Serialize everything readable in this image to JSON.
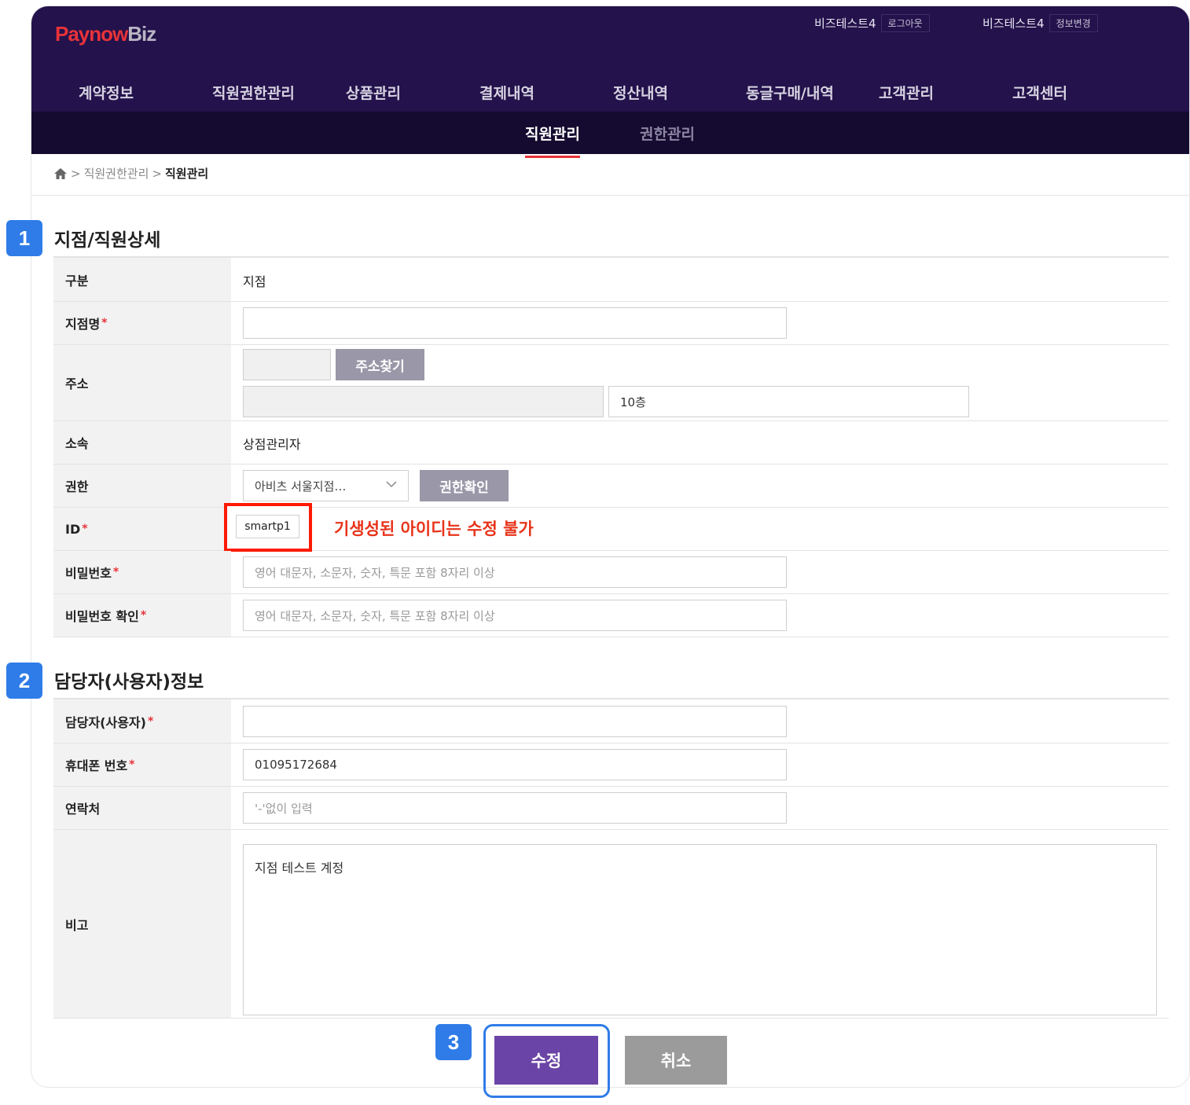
{
  "header": {
    "logo_part1": "Paynow",
    "logo_part2": "Biz",
    "user1": {
      "name": "비즈테스트4",
      "action": "로그아웃"
    },
    "user2": {
      "name": "비즈테스트4",
      "action": "정보변경"
    }
  },
  "gnb": [
    "계약정보",
    "직원권한관리",
    "상품관리",
    "결제내역",
    "정산내역",
    "동글구매/내역",
    "고객관리",
    "고객센터"
  ],
  "subnav": {
    "active": "직원관리",
    "inactive": "권한관리"
  },
  "breadcrumb": {
    "parent": "직원권한관리",
    "current": "직원관리",
    "separator": ">"
  },
  "badges": {
    "one": "1",
    "two": "2",
    "three": "3"
  },
  "section1": {
    "title": "지점/직원상세",
    "rows": {
      "type_label": "구분",
      "type_value": "지점",
      "branch_label": "지점명",
      "branch_value": "",
      "address_label": "주소",
      "address_button": "주소찾기",
      "address_detail": "10층",
      "affiliation_label": "소속",
      "affiliation_value": "상점관리자",
      "permission_label": "권한",
      "permission_value": "아비츠 서울지점…",
      "permission_button": "권한확인",
      "id_label": "ID",
      "id_value": "smartp1",
      "id_note": "기생성된 아이디는 수정 불가",
      "password_label": "비밀번호",
      "password_placeholder": "영어 대문자, 소문자, 숫자, 특문 포함 8자리 이상",
      "password_confirm_label": "비밀번호 확인",
      "password_confirm_placeholder": "영어 대문자, 소문자, 숫자, 특문 포함 8자리 이상"
    }
  },
  "section2": {
    "title": "담당자(사용자)정보",
    "rows": {
      "manager_label": "담당자(사용자)",
      "manager_value": "",
      "mobile_label": "휴대폰 번호",
      "mobile_value": "01095172684",
      "contact_label": "연락처",
      "contact_placeholder": "'-'없이 입력",
      "memo_label": "비고",
      "memo_value": "지점 테스트 계정"
    }
  },
  "buttons": {
    "submit": "수정",
    "cancel": "취소"
  },
  "required_mark": "*",
  "colors": {
    "header_bg": "#23124b",
    "subnav_bg": "#150a2f",
    "accent_red": "#e8333a",
    "badge_blue": "#2f7ce8",
    "submit_purple": "#6a44a6",
    "cancel_gray": "#9b9b9b"
  }
}
